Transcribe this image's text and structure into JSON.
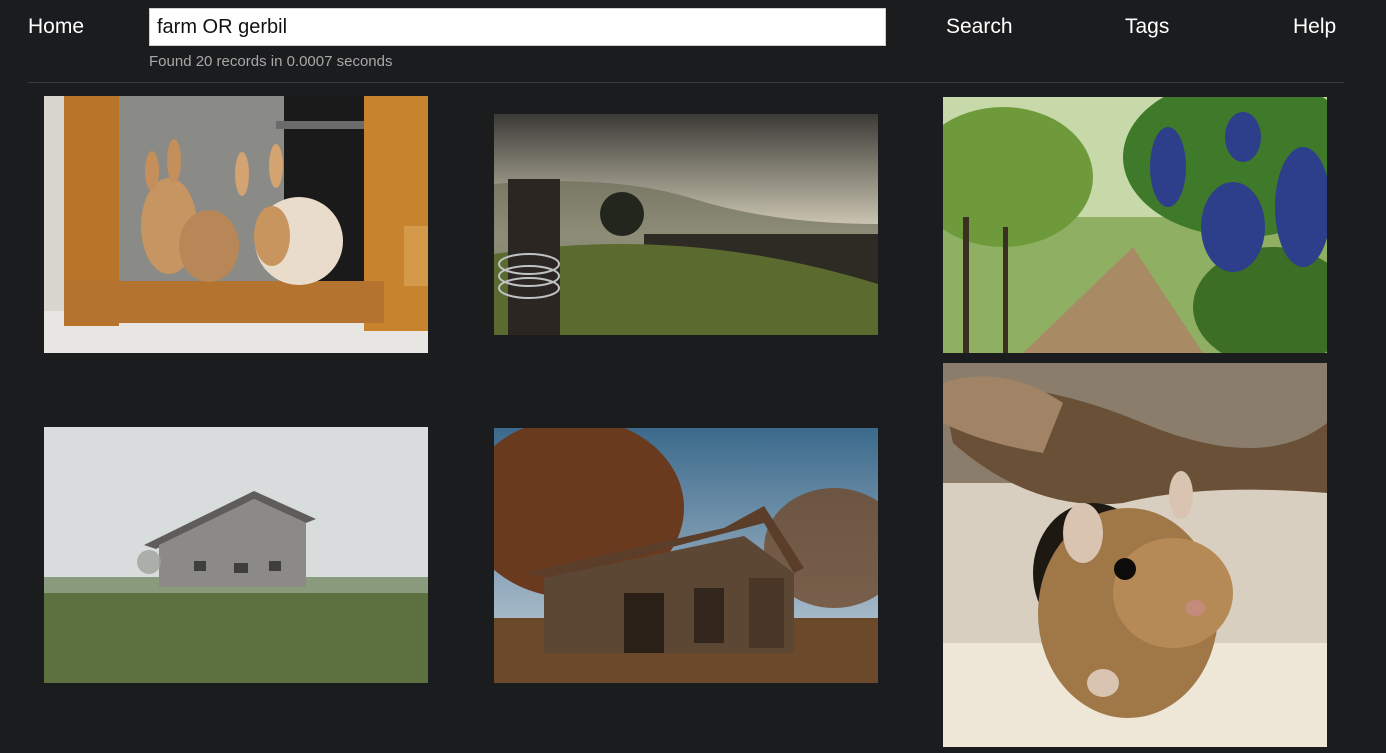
{
  "nav": {
    "home": "Home",
    "search": "Search",
    "tags": "Tags",
    "help": "Help"
  },
  "search": {
    "query": "farm OR gerbil",
    "result_text": "Found 20 records in 0.0007 seconds"
  },
  "results": [
    {
      "subject": "rabbits-in-window"
    },
    {
      "subject": "misty-pasture-fence-post"
    },
    {
      "subject": "vineyard-grapes"
    },
    {
      "subject": "barn-in-fog"
    },
    {
      "subject": "old-wooden-barn"
    },
    {
      "subject": "gerbil"
    }
  ]
}
